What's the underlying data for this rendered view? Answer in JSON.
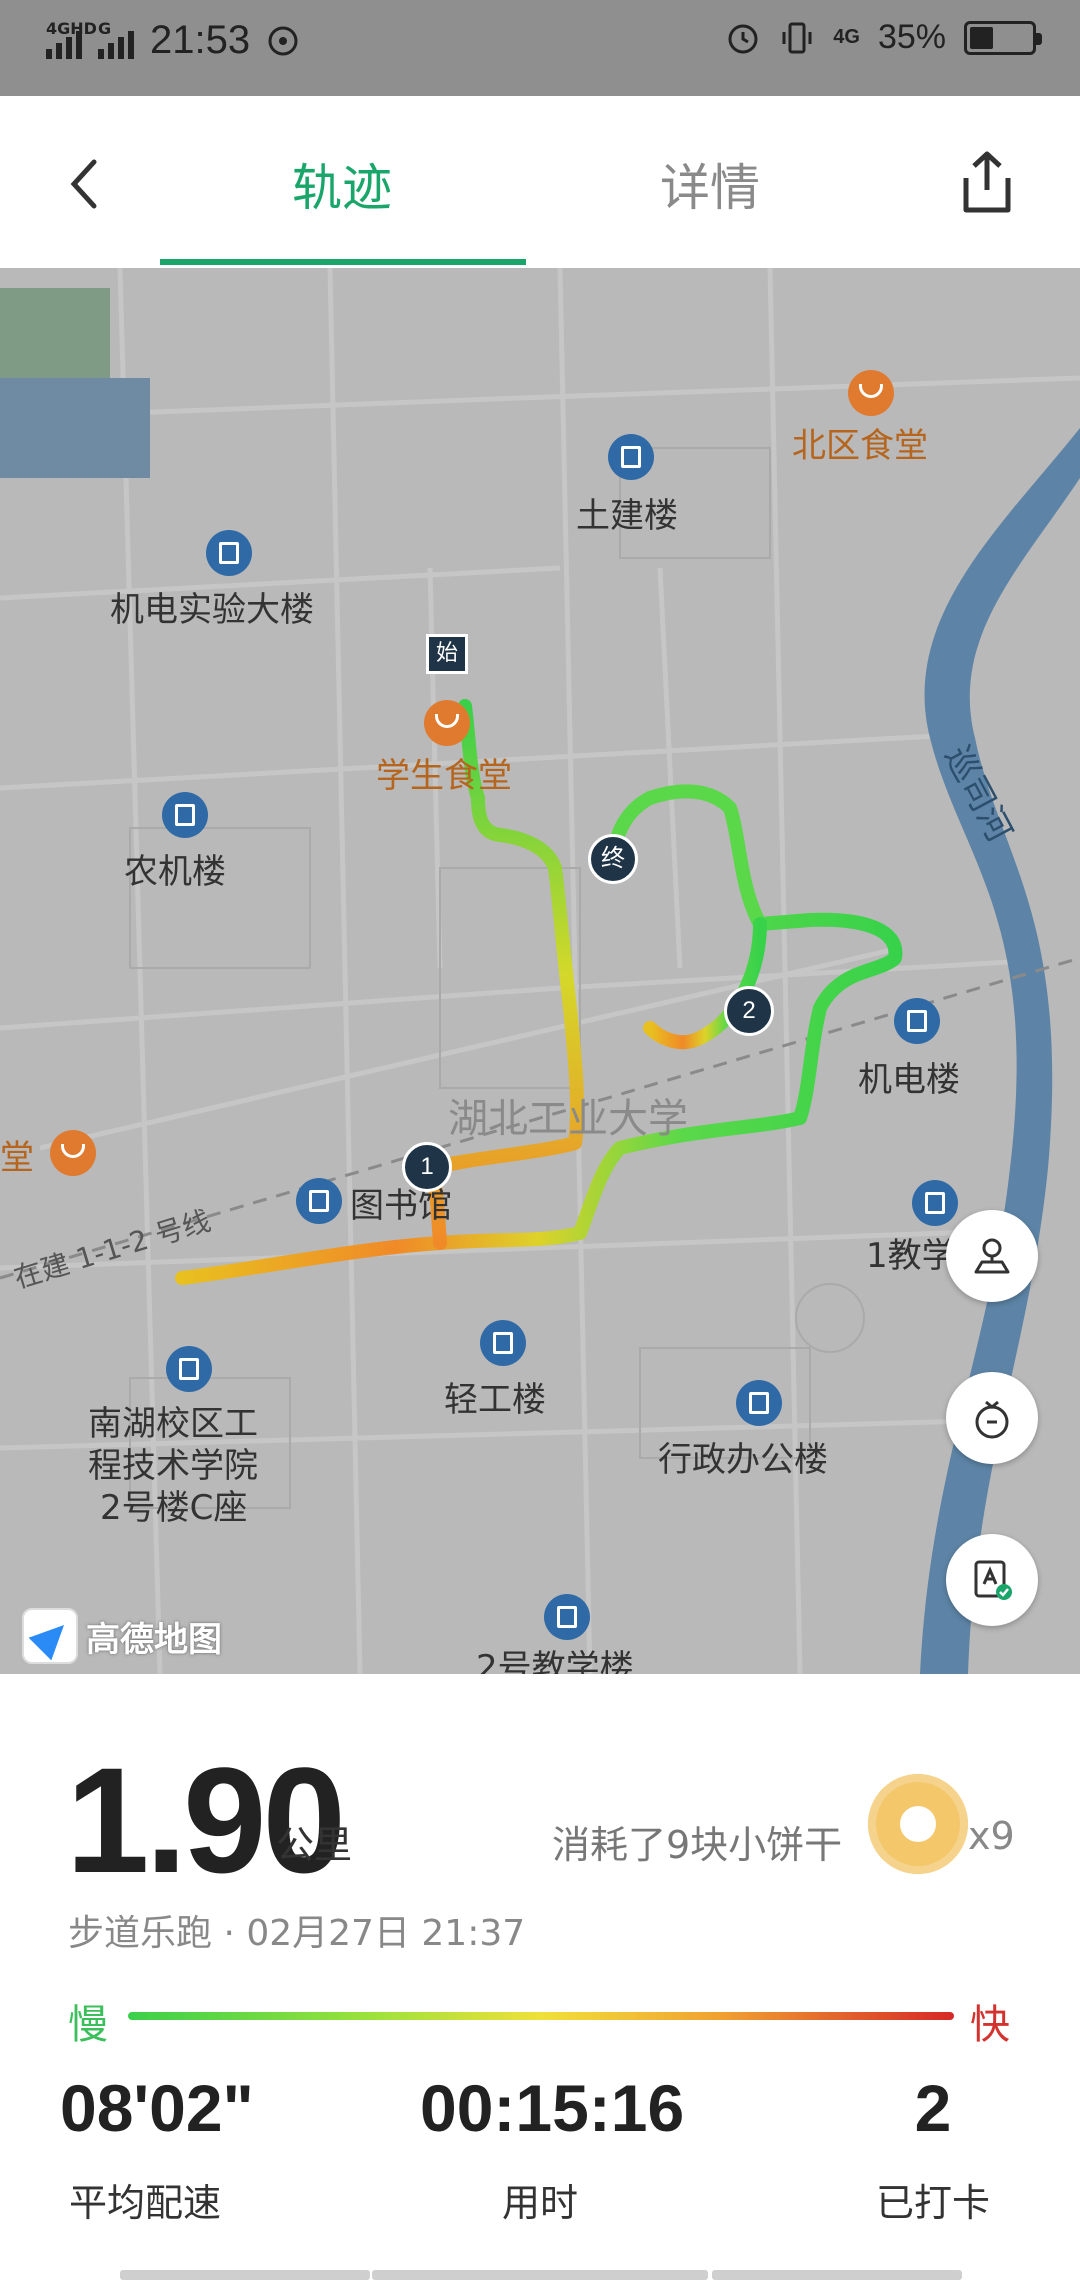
{
  "status_bar": {
    "network": "4GHD",
    "network2": "G",
    "time": "21:53",
    "network3": "4G",
    "battery": "35%",
    "battery_level": 0.35
  },
  "header": {
    "tabs": [
      {
        "label": "轨迹",
        "active": true
      },
      {
        "label": "详情",
        "active": false
      }
    ]
  },
  "map": {
    "pois": {
      "north_canteen": "北区食堂",
      "civil_building": "土建楼",
      "mech_lab": "机电实验大楼",
      "student_canteen": "学生食堂",
      "agri_building": "农机楼",
      "river": "巡司河",
      "university": "湖北工业大学",
      "mech_building": "机电楼",
      "canteen_partial": "堂",
      "library": "图书馆",
      "metro_line": "在建 1-1-2 号线",
      "teaching_1": "1教学",
      "light_building": "轻工楼",
      "nanhu_a": "南湖校区工",
      "nanhu_b": "程技术学院",
      "nanhu_c": "2号楼C座",
      "admin_building": "行政办公楼",
      "teaching_2": "2号教学楼",
      "amap_brand": "高德地图"
    },
    "markers": {
      "start": "始",
      "end": "终",
      "checkpoint_1": "1",
      "checkpoint_2": "2"
    }
  },
  "summary": {
    "distance": "1.90",
    "distance_unit": "公里",
    "cookies_text": "消耗了9块小饼干",
    "cookies_count": "x9",
    "activity_line": "步道乐跑 · 02月27日 21:37",
    "pace_slow": "慢",
    "pace_fast": "快"
  },
  "stats": [
    {
      "value": "08'02\"",
      "label": "平均配速"
    },
    {
      "value": "00:15:16",
      "label": "用时"
    },
    {
      "value": "2",
      "label": "已打卡"
    }
  ],
  "colors": {
    "accent": "#1aa66a",
    "pace_slow": "#3bbf5a",
    "pace_fast": "#d3322e",
    "marker": "#1f3447"
  }
}
